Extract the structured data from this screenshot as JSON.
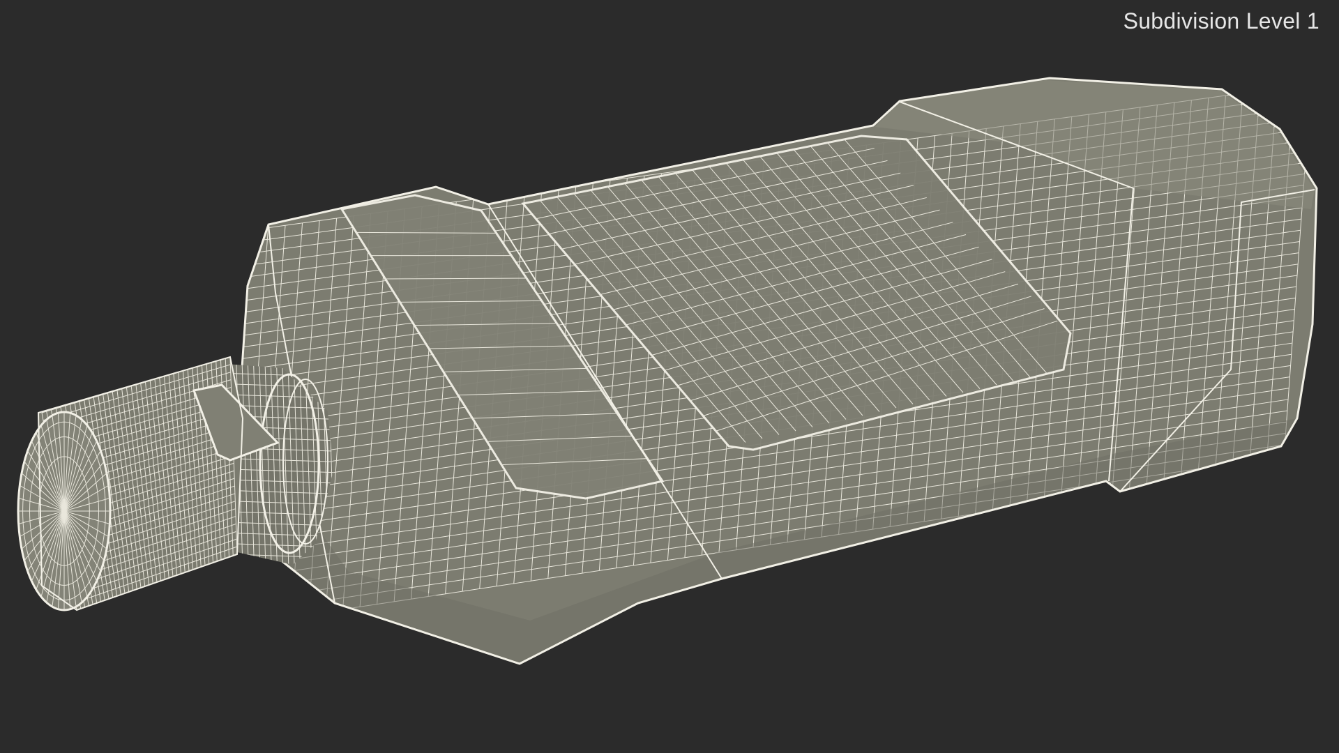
{
  "viewport": {
    "subdivision_label": "Subdivision Level 1",
    "background_color": "#2b2b2b",
    "surface_color": "#7c7c70",
    "wire_color": "#e9e7dc",
    "subject_icon": "wireframe-bottle"
  }
}
